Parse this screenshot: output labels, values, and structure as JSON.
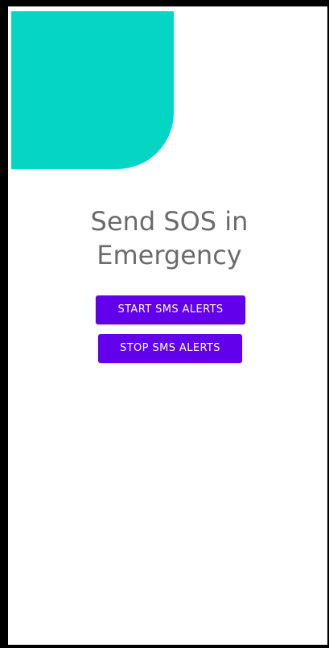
{
  "app": {
    "title_line1": "Send SOS in",
    "title_line2": "Emergency"
  },
  "actions": {
    "start_label": "START SMS ALERTS",
    "stop_label": "STOP SMS ALERTS"
  },
  "colors": {
    "accent": "#04d6c6",
    "button": "#6200ee",
    "title_text": "#6b6b6b",
    "frame": "#000000"
  }
}
